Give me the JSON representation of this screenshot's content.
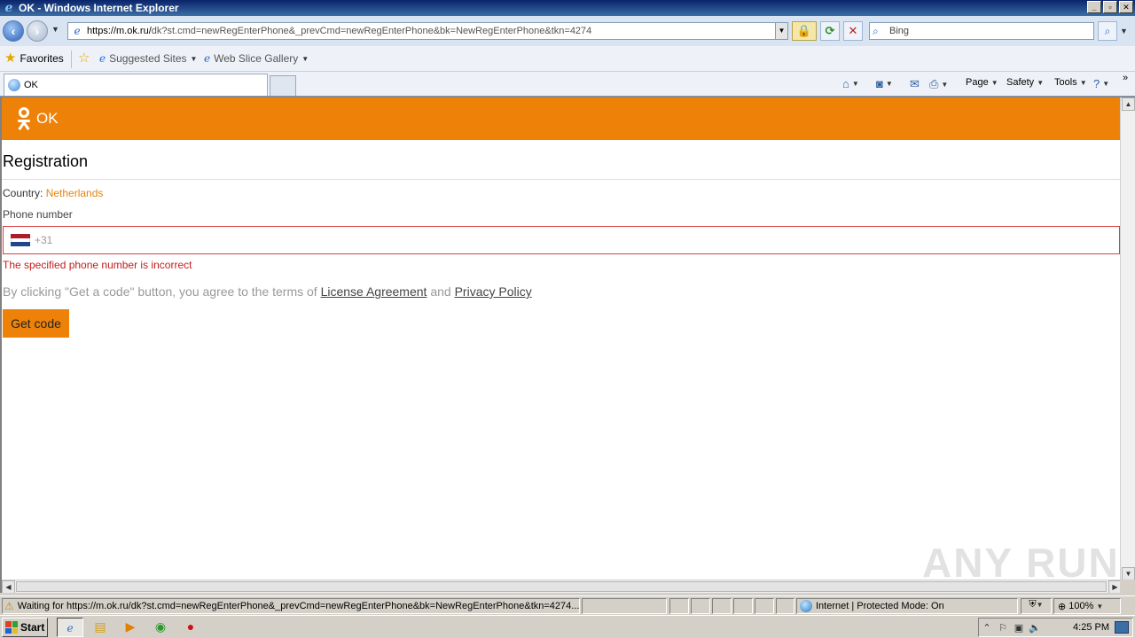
{
  "window": {
    "title": "OK - Windows Internet Explorer",
    "controls": {
      "minimize": "_",
      "maximize": "▫",
      "close": "✕"
    }
  },
  "address_bar": {
    "url_host": "https://m.ok.ru/",
    "url_path": "dk?st.cmd=newRegEnterPhone&_prevCmd=newRegEnterPhone&bk=NewRegEnterPhone&tkn=4274",
    "search_placeholder": "Bing"
  },
  "favorites_bar": {
    "favorites_label": "Favorites",
    "items": [
      {
        "label": "Suggested Sites"
      },
      {
        "label": "Web Slice Gallery"
      }
    ]
  },
  "tabs": [
    {
      "label": "OK"
    }
  ],
  "command_bar": {
    "page_label": "Page",
    "safety_label": "Safety",
    "tools_label": "Tools"
  },
  "page": {
    "site_name": "OK",
    "heading": "Registration",
    "country_label": "Country:",
    "country_value": "Netherlands",
    "phone_label": "Phone number",
    "phone_prefix": "+31",
    "error_message": "The specified phone number is incorrect",
    "terms_prefix": "By clicking \"Get a code\" button, you agree to the terms of ",
    "terms_link1": "License Agreement",
    "terms_and": " and ",
    "terms_link2": "Privacy Policy",
    "submit_label": "Get code",
    "accent_color": "#ee8208",
    "error_color": "#c21d1d"
  },
  "watermark": "ANY RUN",
  "status_bar": {
    "status_text": "Waiting for https://m.ok.ru/dk?st.cmd=newRegEnterPhone&_prevCmd=newRegEnterPhone&bk=NewRegEnterPhone&tkn=4274...",
    "zone_text": "Internet | Protected Mode: On",
    "zoom": "100%"
  },
  "taskbar": {
    "start_label": "Start",
    "clock": "4:25 PM"
  }
}
